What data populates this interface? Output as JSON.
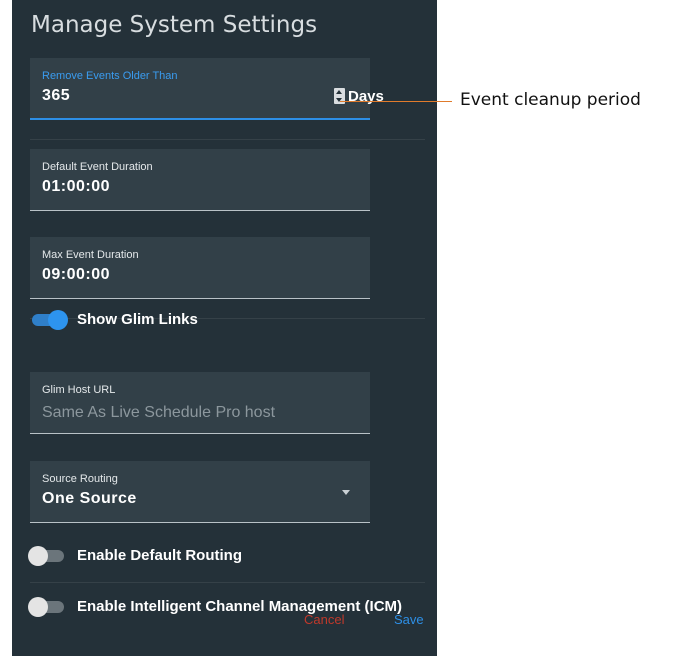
{
  "dialog": {
    "title": "Manage System Settings"
  },
  "fields": {
    "remove_events": {
      "label": "Remove Events Older Than",
      "value": "365",
      "unit": "Days"
    },
    "default_duration": {
      "label": "Default Event Duration",
      "value": "01:00:00"
    },
    "max_duration": {
      "label": "Max Event Duration",
      "value": "09:00:00"
    },
    "glim_host": {
      "label": "Glim Host URL",
      "placeholder": "Same As Live Schedule Pro host"
    },
    "source_routing": {
      "label": "Source Routing",
      "value": "One Source"
    }
  },
  "toggles": {
    "show_glim": {
      "label": "Show Glim Links",
      "on": true
    },
    "default_routing": {
      "label": "Enable Default Routing",
      "on": false
    },
    "icm": {
      "label": "Enable Intelligent Channel Management (ICM)",
      "on": false
    }
  },
  "actions": {
    "cancel": "Cancel",
    "save": "Save"
  },
  "annotation": {
    "callout": "Event cleanup period"
  },
  "colors": {
    "panel": "#243139",
    "field": "#324048",
    "accent": "#2d94ef",
    "cancel": "#c0392b",
    "callout_line": "#e07b2c"
  }
}
